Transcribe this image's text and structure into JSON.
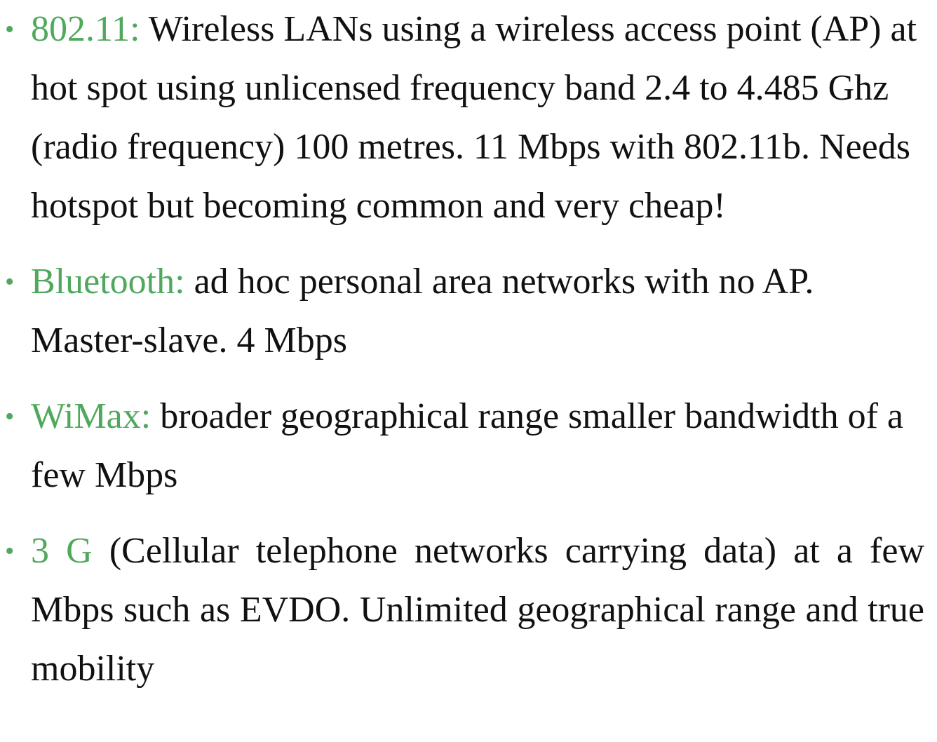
{
  "colors": {
    "accent": "#4fa85c",
    "text": "#111111",
    "background": "#ffffff"
  },
  "bullets": [
    {
      "term": "802.11:",
      "text": " Wireless LANs using a  wireless access  point (AP)  at hot spot using unlicensed frequency  band 2.4 to 4.485 Ghz (radio  frequency) 100  metres. 11 Mbps with 802.11b. Needs hotspot but  becoming common and very  cheap!"
    },
    {
      "term": "Bluetooth:",
      "text": " ad hoc personal area networks with no AP. Master-slave.  4 Mbps"
    },
    {
      "term": "WiMax:",
      "text": " broader geographical range smaller bandwidth of a  few  Mbps"
    },
    {
      "term": "3 G",
      "text": " (Cellular telephone networks carrying data) at a few Mbps such as EVDO. Unlimited geographical range and true mobility"
    }
  ],
  "bullet_symbol": "•"
}
